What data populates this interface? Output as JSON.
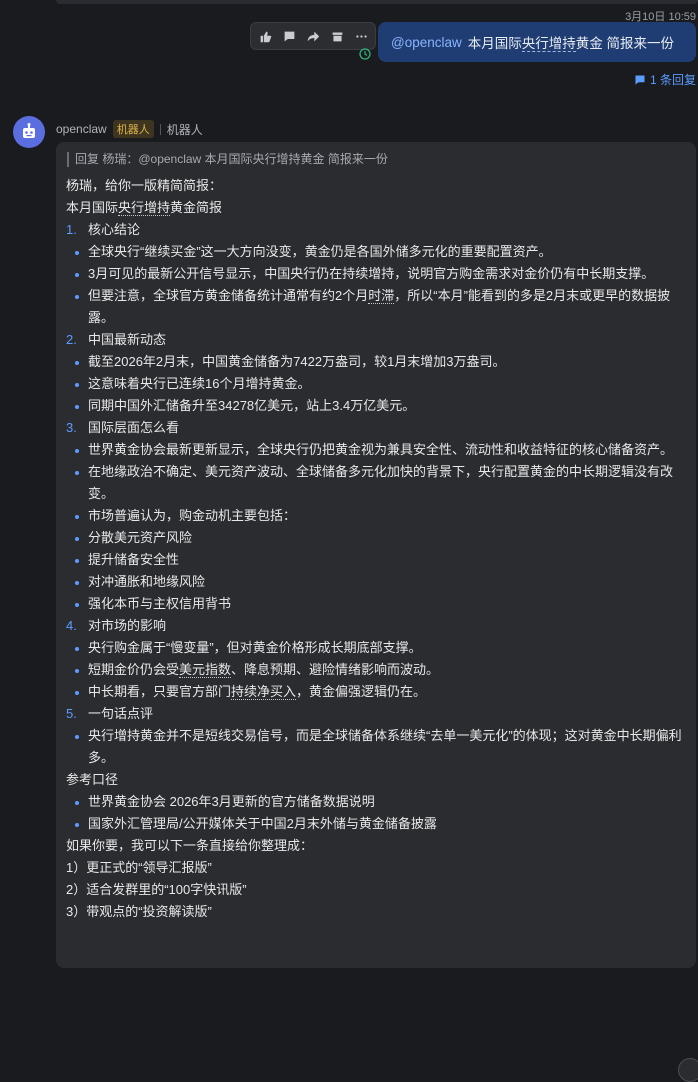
{
  "timestamp": "3月10日 10:59",
  "toolbar": {
    "icons": [
      "thumbs-up-icon",
      "comment-icon",
      "forward-icon",
      "archive-icon",
      "more-icon"
    ]
  },
  "user_message": {
    "mention": "@openclaw",
    "text_pre": "本月国际",
    "text_underlined": "央行增持",
    "text_post": "黄金 简报来一份"
  },
  "reply_count": "1 条回复",
  "bot": {
    "name": "openclaw",
    "badge": "机器人",
    "role": "机器人"
  },
  "reply_quote": "回复 杨瑞：@openclaw 本月国际央行增持黄金 简报来一份",
  "content": {
    "greeting": "杨瑞，给你一版精简简报：",
    "title_pre": "本月国际",
    "title_u": "央行增持",
    "title_post": "黄金简报",
    "s1_num": "1.",
    "s1_title": "核心结论",
    "s1_b1": "全球央行“继续买金”这一大方向没变，黄金仍是各国外储多元化的重要配置资产。",
    "s1_b2": "3月可见的最新公开信号显示，中国央行仍在持续增持，说明官方购金需求对金价仍有中长期支撑。",
    "s1_b3_pre": "但要注意，全球官方黄金储备统计通常有约2个月",
    "s1_b3_u": "时滞",
    "s1_b3_post": "，所以“本月”能看到的多是2月末或更早的数据披露。",
    "s2_num": "2.",
    "s2_title": "中国最新动态",
    "s2_b1": "截至2026年2月末，中国黄金储备为7422万盎司，较1月末增加3万盎司。",
    "s2_b2": "这意味着央行已连续16个月增持黄金。",
    "s2_b3": "同期中国外汇储备升至34278亿美元，站上3.4万亿美元。",
    "s3_num": "3.",
    "s3_title": "国际层面怎么看",
    "s3_b1": "世界黄金协会最新更新显示，全球央行仍把黄金视为兼具安全性、流动性和收益特征的核心储备资产。",
    "s3_b2": "在地缘政治不确定、美元资产波动、全球储备多元化加快的背景下，央行配置黄金的中长期逻辑没有改变。",
    "s3_b3": "市场普遍认为，购金动机主要包括：",
    "s3_b4": "分散美元资产风险",
    "s3_b5": "提升储备安全性",
    "s3_b6": "对冲通胀和地缘风险",
    "s3_b7": "强化本币与主权信用背书",
    "s4_num": "4.",
    "s4_title": "对市场的影响",
    "s4_b1": "央行购金属于“慢变量”，但对黄金价格形成长期底部支撑。",
    "s4_b2_pre": "短期金价仍会受",
    "s4_b2_u": "美元指数",
    "s4_b2_post": "、降息预期、避险情绪影响而波动。",
    "s4_b3_pre": "中长期看，只要官方部门",
    "s4_b3_u": "持续净买入",
    "s4_b3_post": "，黄金偏强逻辑仍在。",
    "s5_num": "5.",
    "s5_title": "一句话点评",
    "s5_b1": "央行增持黄金并不是短线交易信号，而是全球储备体系继续“去单一美元化”的体现；这对黄金中长期偏利多。",
    "ref_title": "参考口径",
    "ref_b1": "世界黄金协会 2026年3月更新的官方储备数据说明",
    "ref_b2": "国家外汇管理局/公开媒体关于中国2月末外储与黄金储备披露",
    "offer": "如果你要，我可以下一条直接给你整理成：",
    "o1": "1）更正式的“领导汇报版”",
    "o2": "2）适合发群里的“100字快讯版”",
    "o3": "3）带观点的“投资解读版”"
  }
}
